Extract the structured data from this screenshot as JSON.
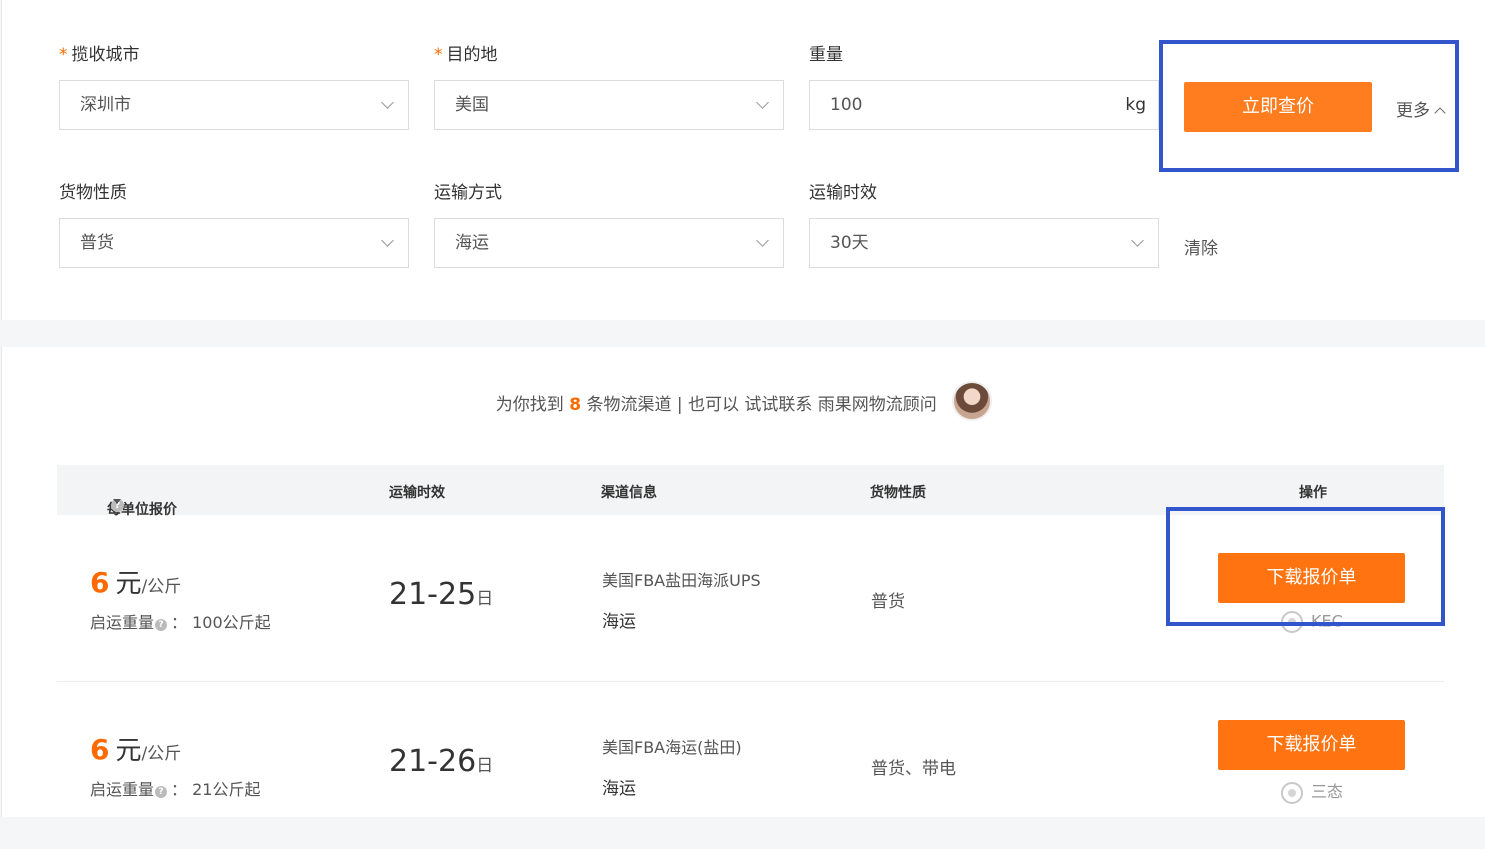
{
  "filters": {
    "pickup_city": {
      "label": "揽收城市",
      "required_mark": "*",
      "value": "深圳市"
    },
    "destination": {
      "label": "目的地",
      "required_mark": "*",
      "value": "美国"
    },
    "weight": {
      "label": "重量",
      "value": "100",
      "unit": "kg"
    },
    "cargo_type": {
      "label": "货物性质",
      "value": "普货"
    },
    "shipping_method": {
      "label": "运输方式",
      "value": "海运"
    },
    "transit_time": {
      "label": "运输时效",
      "value": "30天"
    },
    "query_button": "立即查价",
    "more_label": "更多",
    "clear_label": "清除"
  },
  "summary": {
    "prefix": "为你找到",
    "count": "8",
    "suffix": "条物流渠道 | 也可以 试试联系 雨果网物流顾问"
  },
  "table": {
    "headers": {
      "price": "每单位报价",
      "transit": "运输时效",
      "channel": "渠道信息",
      "cargo": "货物性质",
      "action": "操作"
    },
    "rows": [
      {
        "price": "6",
        "currency": "元",
        "per_unit": "/公斤",
        "min_weight_label": "启运重量",
        "min_weight": "100公斤起",
        "transit_range": "21-25",
        "transit_unit": "日",
        "channel_name": "美国FBA盐田海派UPS",
        "channel_mode": "海运",
        "cargo": "普货",
        "download_label": "下载报价单",
        "consultant": "KEC"
      },
      {
        "price": "6",
        "currency": "元",
        "per_unit": "/公斤",
        "min_weight_label": "启运重量",
        "min_weight": "21公斤起",
        "transit_range": "21-26",
        "transit_unit": "日",
        "channel_name": "美国FBA海运(盐田)",
        "channel_mode": "海运",
        "cargo": "普货、带电",
        "download_label": "下载报价单",
        "consultant": "三态"
      }
    ]
  },
  "colors": {
    "accent": "#ff7c1f",
    "price": "#ff6a00",
    "highlight_box": "#3355cc"
  }
}
